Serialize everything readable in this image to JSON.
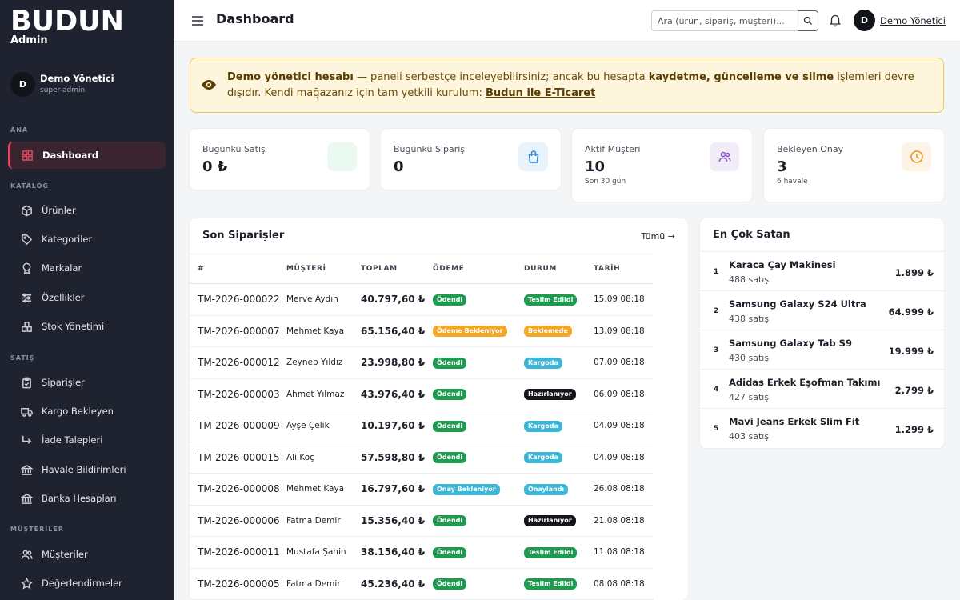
{
  "sidebar": {
    "brand": "BUDUN",
    "brand_sub": "Admin",
    "user_initial": "D",
    "user_name": "Demo Yönetici",
    "user_role": "super-admin",
    "sections": {
      "ana": "ANA",
      "katalog": "KATALOG",
      "satis": "SATIŞ",
      "musteriler": "MÜŞTERİLER"
    },
    "items": {
      "dashboard": "Dashboard",
      "urunler": "Ürünler",
      "kategoriler": "Kategoriler",
      "markalar": "Markalar",
      "ozellikler": "Özellikler",
      "stok": "Stok Yönetimi",
      "siparisler": "Siparişler",
      "kargo": "Kargo Bekleyen",
      "iade": "İade Talepleri",
      "havale": "Havale Bildirimleri",
      "banka": "Banka Hesapları",
      "musteriler": "Müşteriler",
      "degerlendirmeler": "Değerlendirmeler"
    }
  },
  "header": {
    "title": "Dashboard",
    "search_placeholder": "Ara (ürün, sipariş, müşteri)...",
    "user_initial": "D",
    "user_name": "Demo Yönetici"
  },
  "alert": {
    "strong1": "Demo yönetici hesabı",
    "text1": " — paneli serbestçe inceleyebilirsiniz; ancak bu hesapta ",
    "strong2": "kaydetme, güncelleme ve silme",
    "text2": " işlemleri devre dışıdır. Kendi mağazanız için tam yetkili kurulum: ",
    "link": "Budun ile E-Ticaret"
  },
  "stats": {
    "sales": {
      "label": "Bugünkü Satış",
      "value": "0 ₺",
      "color": "#eafaf0"
    },
    "orders": {
      "label": "Bugünkü Sipariş",
      "value": "0",
      "color": "#e8f3fb"
    },
    "customers": {
      "label": "Aktif Müşteri",
      "value": "10",
      "sub": "Son 30 gün",
      "color": "#f1ecf8"
    },
    "pending": {
      "label": "Bekleyen Onay",
      "value": "3",
      "sub": "6 havale",
      "color": "#fdf3e6"
    }
  },
  "orders": {
    "title": "Son Siparişler",
    "all_link": "Tümü →",
    "columns": [
      "#",
      "MÜŞTERİ",
      "TOPLAM",
      "ÖDEME",
      "DURUM",
      "TARİH"
    ],
    "rows": [
      {
        "id": "TM-2026-000022",
        "customer": "Merve Aydın",
        "total": "40.797,60 ₺",
        "payment": "Ödendi",
        "payment_color": "#1e9b4f",
        "status": "Teslim Edildi",
        "status_color": "#1e9b4f",
        "date": "15.09 08:18"
      },
      {
        "id": "TM-2026-000007",
        "customer": "Mehmet Kaya",
        "total": "65.156,40 ₺",
        "payment": "Ödeme Bekleniyor",
        "payment_color": "#f5a623",
        "status": "Beklemede",
        "status_color": "#f5a623",
        "date": "13.09 08:18"
      },
      {
        "id": "TM-2026-000012",
        "customer": "Zeynep Yıldız",
        "total": "23.998,80 ₺",
        "payment": "Ödendi",
        "payment_color": "#1e9b4f",
        "status": "Kargoda",
        "status_color": "#3bb6d6",
        "date": "07.09 08:18"
      },
      {
        "id": "TM-2026-000003",
        "customer": "Ahmet Yılmaz",
        "total": "43.976,40 ₺",
        "payment": "Ödendi",
        "payment_color": "#1e9b4f",
        "status": "Hazırlanıyor",
        "status_color": "#14161c",
        "date": "06.09 08:18"
      },
      {
        "id": "TM-2026-000009",
        "customer": "Ayşe Çelik",
        "total": "10.197,60 ₺",
        "payment": "Ödendi",
        "payment_color": "#1e9b4f",
        "status": "Kargoda",
        "status_color": "#3bb6d6",
        "date": "04.09 08:18"
      },
      {
        "id": "TM-2026-000015",
        "customer": "Ali Koç",
        "total": "57.598,80 ₺",
        "payment": "Ödendi",
        "payment_color": "#1e9b4f",
        "status": "Kargoda",
        "status_color": "#3bb6d6",
        "date": "04.09 08:18"
      },
      {
        "id": "TM-2026-000008",
        "customer": "Mehmet Kaya",
        "total": "16.797,60 ₺",
        "payment": "Onay Bekleniyor",
        "payment_color": "#3bb6d6",
        "status": "Onaylandı",
        "status_color": "#3bb6d6",
        "date": "26.08 08:18"
      },
      {
        "id": "TM-2026-000006",
        "customer": "Fatma Demir",
        "total": "15.356,40 ₺",
        "payment": "Ödendi",
        "payment_color": "#1e9b4f",
        "status": "Hazırlanıyor",
        "status_color": "#14161c",
        "date": "21.08 08:18"
      },
      {
        "id": "TM-2026-000011",
        "customer": "Mustafa Şahin",
        "total": "38.156,40 ₺",
        "payment": "Ödendi",
        "payment_color": "#1e9b4f",
        "status": "Teslim Edildi",
        "status_color": "#1e9b4f",
        "date": "11.08 08:18"
      },
      {
        "id": "TM-2026-000005",
        "customer": "Fatma Demir",
        "total": "45.236,40 ₺",
        "payment": "Ödendi",
        "payment_color": "#1e9b4f",
        "status": "Teslim Edildi",
        "status_color": "#1e9b4f",
        "date": "08.08 08:18"
      }
    ]
  },
  "bestsellers": {
    "title": "En Çok Satan",
    "items": [
      {
        "rank": "1",
        "name": "Karaca Çay Makinesi",
        "sales": "488 satış",
        "price": "1.899 ₺"
      },
      {
        "rank": "2",
        "name": "Samsung Galaxy S24 Ultra",
        "sales": "438 satış",
        "price": "64.999 ₺"
      },
      {
        "rank": "3",
        "name": "Samsung Galaxy Tab S9",
        "sales": "430 satış",
        "price": "19.999 ₺"
      },
      {
        "rank": "4",
        "name": "Adidas Erkek Eşofman Takımı",
        "sales": "427 satış",
        "price": "2.799 ₺"
      },
      {
        "rank": "5",
        "name": "Mavi Jeans Erkek Slim Fit",
        "sales": "403 satış",
        "price": "1.299 ₺"
      }
    ]
  }
}
